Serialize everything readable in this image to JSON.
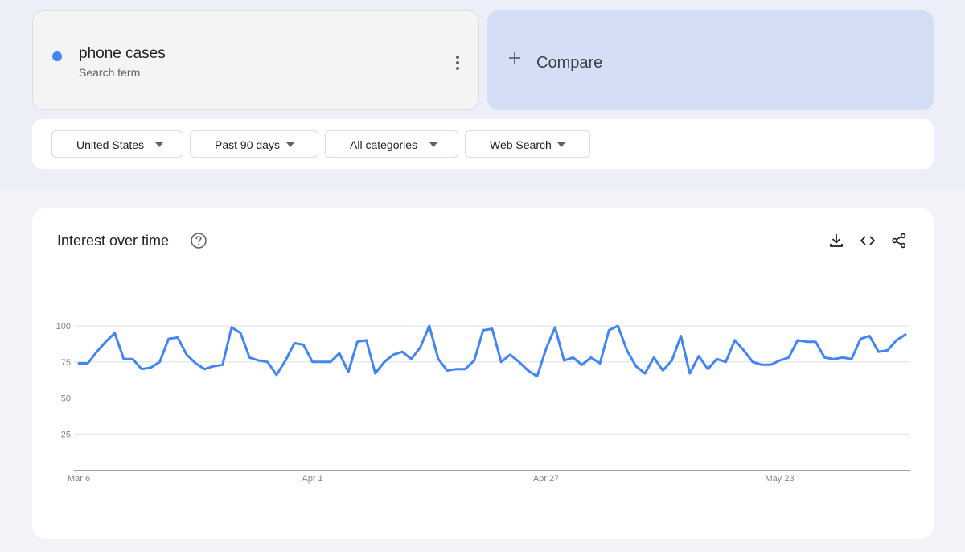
{
  "search_term": {
    "label": "phone cases",
    "sublabel": "Search term",
    "color": "#4285f4"
  },
  "compare": {
    "label": "Compare"
  },
  "filters": [
    {
      "label": "United States"
    },
    {
      "label": "Past 90 days"
    },
    {
      "label": "All categories"
    },
    {
      "label": "Web Search"
    }
  ],
  "chart_panel": {
    "title": "Interest over time"
  },
  "icons": {
    "help": "help-circle-icon",
    "download": "download-icon",
    "embed": "code-icon",
    "share": "share-icon"
  },
  "chart_data": {
    "type": "line",
    "title": "Interest over time",
    "ylim": [
      0,
      100
    ],
    "yticks": [
      25,
      50,
      75,
      100
    ],
    "xtick_labels": [
      {
        "index": 0,
        "label": "Mar 6"
      },
      {
        "index": 26,
        "label": "Apr 1"
      },
      {
        "index": 52,
        "label": "Apr 27"
      },
      {
        "index": 78,
        "label": "May 23"
      }
    ],
    "grid": true,
    "series": [
      {
        "name": "phone cases",
        "color": "#4285f4",
        "values": [
          74,
          74,
          82,
          89,
          95,
          77,
          77,
          70,
          71,
          75,
          91,
          92,
          80,
          74,
          70,
          72,
          73,
          99,
          95,
          78,
          76,
          75,
          66,
          76,
          88,
          87,
          75,
          75,
          75,
          81,
          68,
          89,
          90,
          67,
          75,
          80,
          82,
          77,
          85,
          100,
          77,
          69,
          70,
          70,
          76,
          97,
          98,
          75,
          80,
          75,
          69,
          65,
          84,
          99,
          76,
          78,
          73,
          78,
          74,
          97,
          100,
          83,
          72,
          67,
          78,
          69,
          76,
          93,
          67,
          79,
          70,
          77,
          75,
          90,
          83,
          75,
          73,
          73,
          76,
          78,
          90,
          89,
          89,
          78,
          77,
          78,
          77,
          91,
          93,
          82,
          83,
          90,
          94
        ]
      }
    ]
  }
}
